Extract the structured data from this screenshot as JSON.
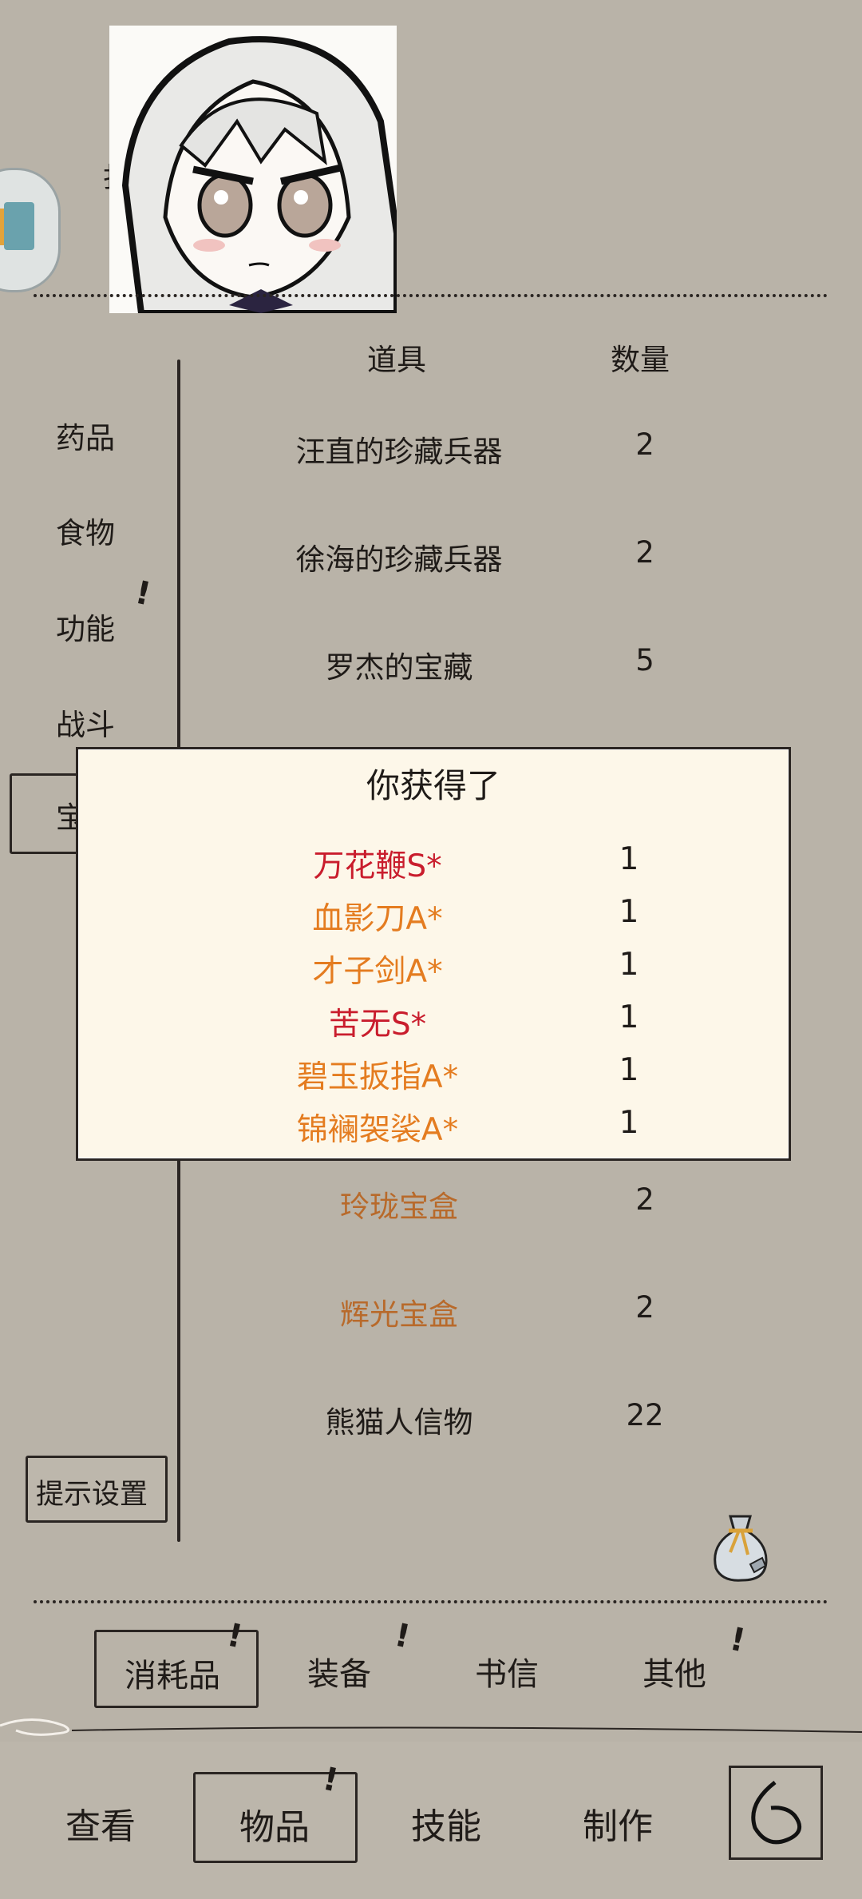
{
  "header": {
    "item_col": "道具",
    "qty_col": "数量"
  },
  "categories": [
    "药品",
    "食物",
    "功能",
    "战斗",
    "宝"
  ],
  "items": [
    {
      "name": "汪直的珍藏兵器",
      "qty": "2"
    },
    {
      "name": "徐海的珍藏兵器",
      "qty": "2"
    },
    {
      "name": "罗杰的宝藏",
      "qty": "5"
    },
    {
      "name": "玲珑宝盒",
      "qty": "2"
    },
    {
      "name": "辉光宝盒",
      "qty": "2"
    },
    {
      "name": "熊猫人信物",
      "qty": "22"
    }
  ],
  "hint_settings_label": "提示设置",
  "popup": {
    "title": "你获得了",
    "rewards": [
      {
        "name": "万花鞭S*",
        "qty": "1"
      },
      {
        "name": "血影刀A*",
        "qty": "1"
      },
      {
        "name": "才子剑A*",
        "qty": "1"
      },
      {
        "name": "苦无S*",
        "qty": "1"
      },
      {
        "name": "碧玉扳指A*",
        "qty": "1"
      },
      {
        "name": "锦襕袈裟A*",
        "qty": "1"
      }
    ]
  },
  "sub_tabs": [
    "消耗品",
    "装备",
    "书信",
    "其他"
  ],
  "bottom_nav": [
    "查看",
    "物品",
    "技能",
    "制作"
  ],
  "colors": {
    "background": "#b9b3a8",
    "popup_bg": "#fdf7e9",
    "s_rank": "#c91d2d",
    "a_rank": "#e47c20",
    "treasure_box": "#b86a2b"
  },
  "icons": {
    "loot_bag": "loot-bag-icon",
    "back": "back-arrow-icon",
    "alert": "exclamation-icon"
  }
}
